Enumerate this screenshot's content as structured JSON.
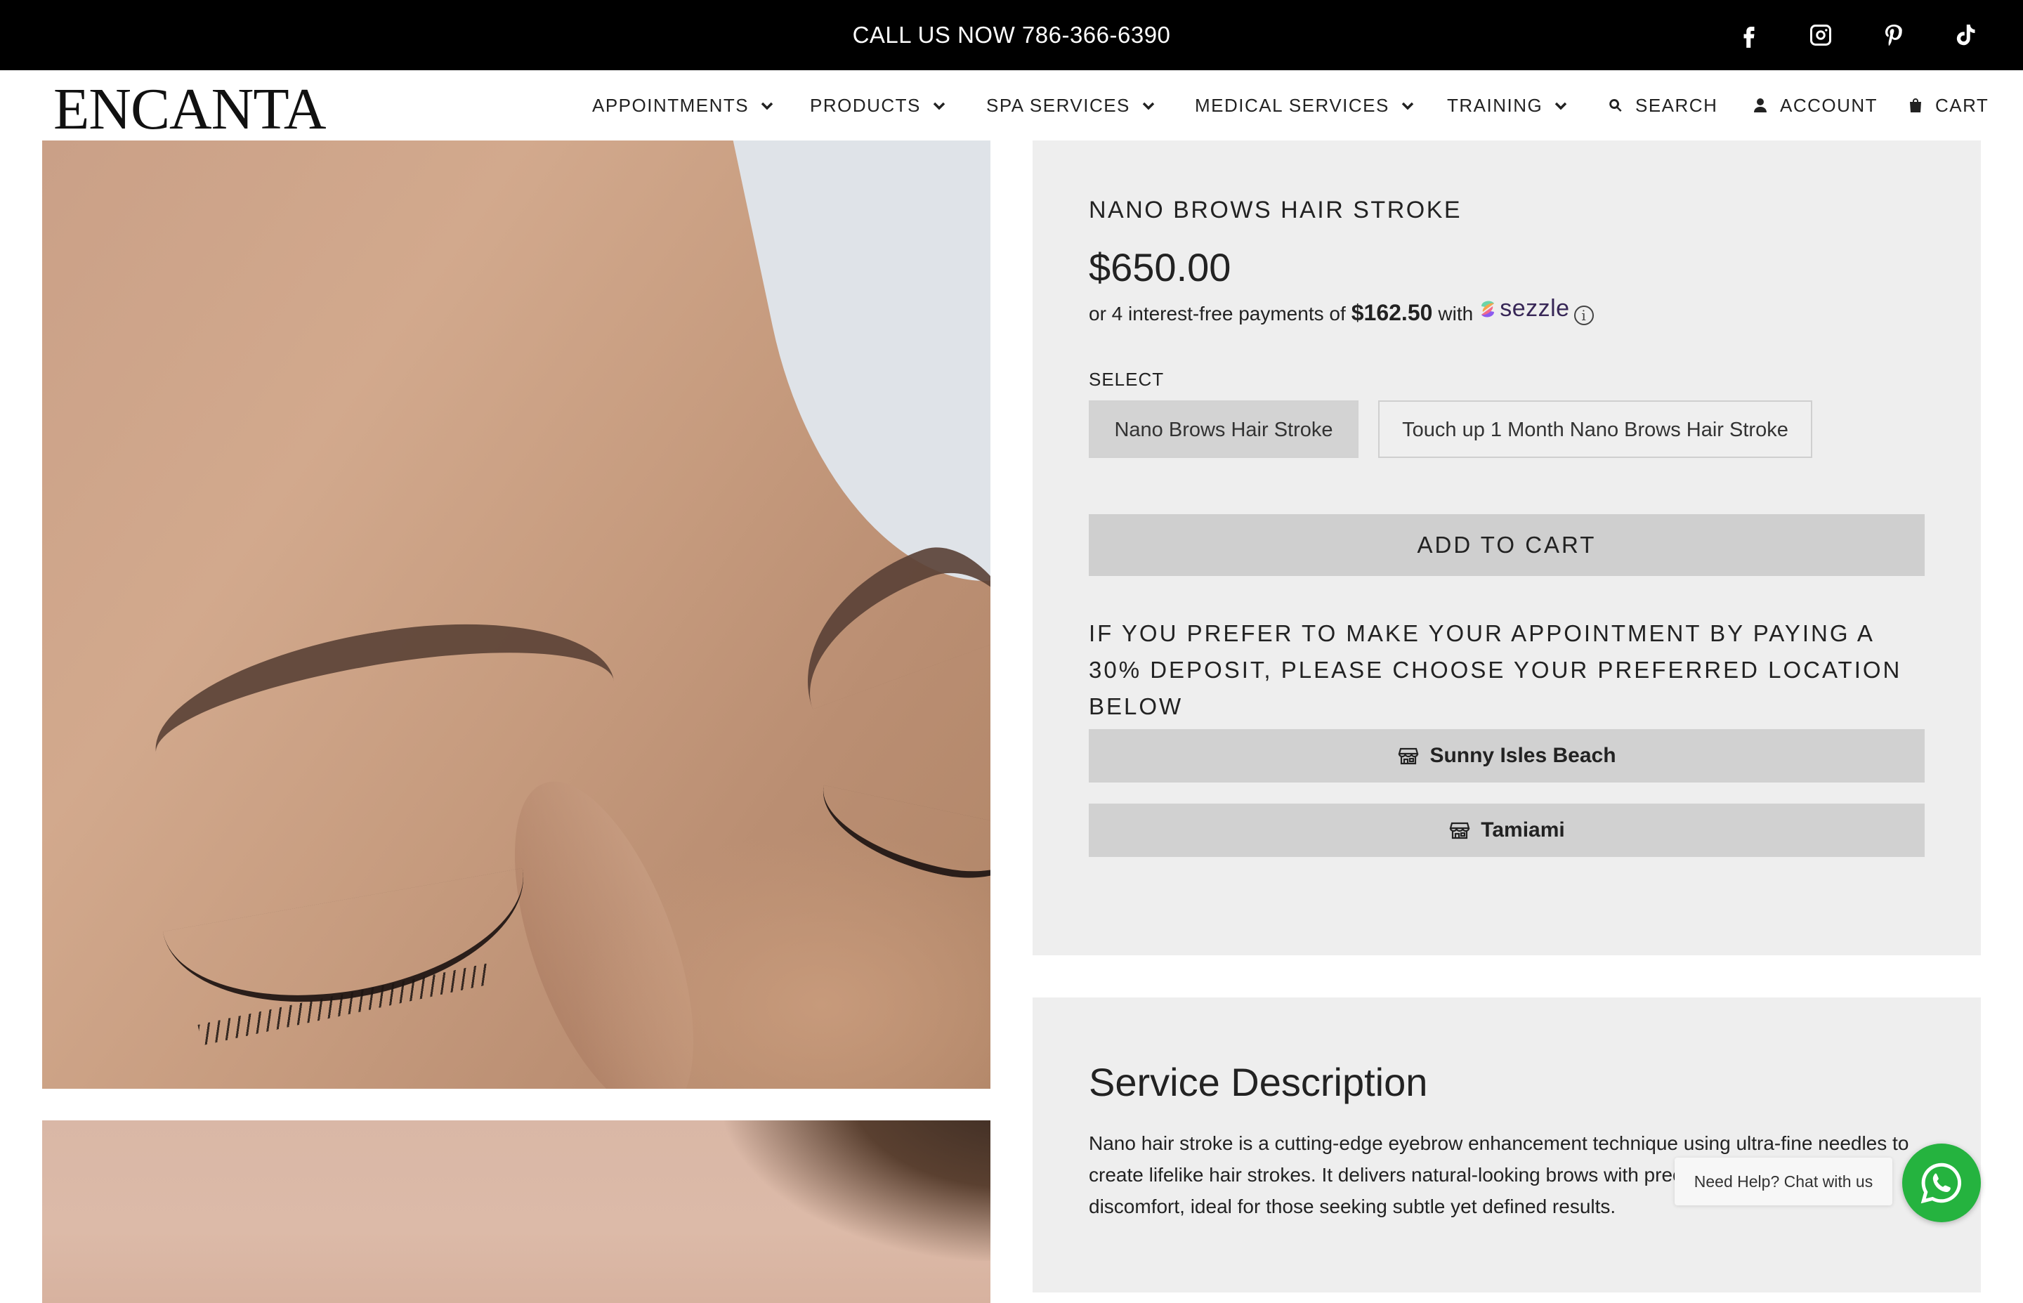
{
  "announcement": {
    "text": "CALL US NOW 786-366-6390"
  },
  "social": [
    {
      "icon": "facebook-icon"
    },
    {
      "icon": "instagram-icon"
    },
    {
      "icon": "pinterest-icon"
    },
    {
      "icon": "tiktok-icon"
    }
  ],
  "header": {
    "logo": "ENCANTA",
    "nav": {
      "appointments": "APPOINTMENTS",
      "products": "PRODUCTS",
      "spa": "SPA SERVICES",
      "medical": "MEDICAL SERVICES",
      "training": "TRAINING",
      "search": "SEARCH",
      "account": "ACCOUNT",
      "cart": "CART"
    }
  },
  "product": {
    "title": "NANO BROWS HAIR STROKE",
    "price": "$650.00",
    "sezzle": {
      "prefix": "or 4 interest-free payments of",
      "amount": "$162.50",
      "with": "with",
      "brand": "sezzle",
      "info": "i"
    },
    "select_label": "SELECT",
    "options": [
      {
        "label": "Nano Brows Hair Stroke",
        "selected": true
      },
      {
        "label": "Touch up 1 Month Nano Brows Hair Stroke",
        "selected": false
      }
    ],
    "add_to_cart": "ADD TO CART",
    "deposit_text": "IF YOU PREFER TO MAKE YOUR APPOINTMENT BY PAYING A 30% DEPOSIT, PLEASE CHOOSE YOUR PREFERRED LOCATION BELOW",
    "locations": [
      "Sunny Isles Beach",
      "Tamiami"
    ]
  },
  "description": {
    "heading": "Service Description",
    "body": "Nano hair stroke is a cutting-edge eyebrow enhancement technique using ultra-fine needles to create lifelike hair strokes. It delivers natural-looking brows with precision and minimal discomfort, ideal for those seeking subtle yet defined results."
  },
  "chat": {
    "label": "Need Help? Chat with us",
    "icon": "whatsapp-icon"
  },
  "colors": {
    "topbar": "#000000",
    "panel": "#eeeeee",
    "button": "#cfcfcf",
    "whatsapp": "#25b33f",
    "sezzle": "#382757"
  }
}
